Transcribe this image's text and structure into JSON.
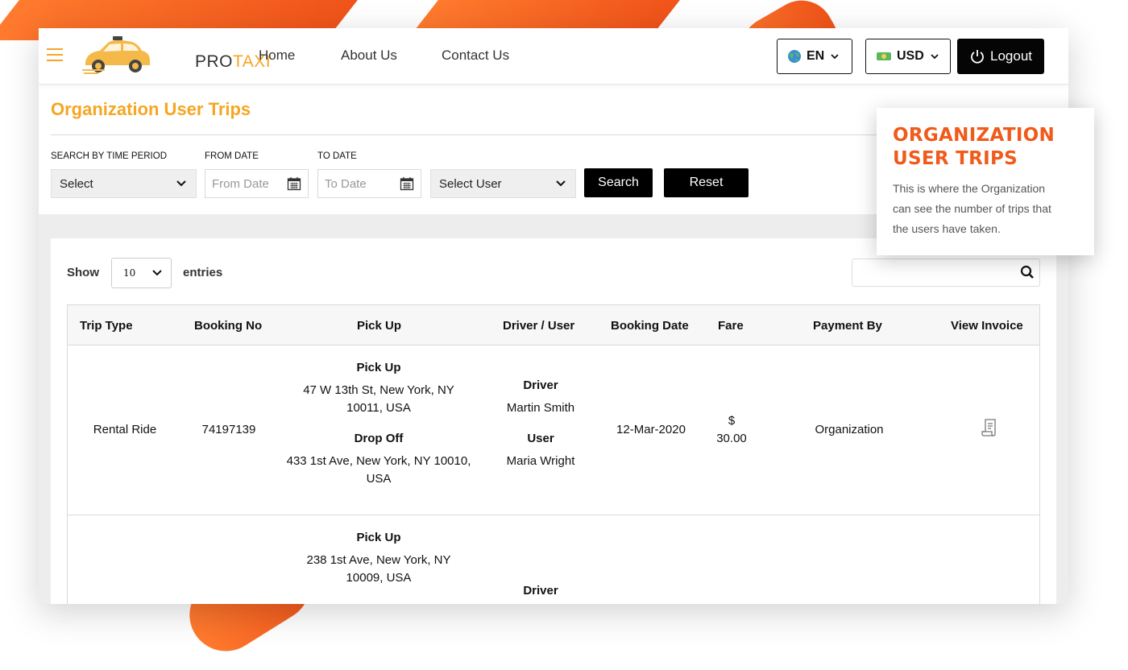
{
  "brand": {
    "pro": "PRO",
    "taxi": "TAXI",
    "accent": "#f5a623",
    "decor": "#f0541a"
  },
  "nav": {
    "home": "Home",
    "about": "About Us",
    "contact": "Contact Us"
  },
  "header": {
    "language": "EN",
    "currency": "USD",
    "logout": "Logout"
  },
  "page": {
    "title": "Organization User Trips"
  },
  "filters": {
    "time_label": "SEARCH BY TIME PERIOD",
    "time_value": "Select",
    "from_label": "FROM DATE",
    "from_placeholder": "From Date",
    "to_label": "TO DATE",
    "to_placeholder": "To Date",
    "user_value": "Select User",
    "search": "Search",
    "reset": "Reset"
  },
  "table_controls": {
    "show": "Show",
    "entries_value": "10",
    "entries": "entries"
  },
  "table": {
    "headers": [
      "Trip Type",
      "Booking No",
      "Pick Up",
      "Driver / User",
      "Booking Date",
      "Fare",
      "Payment By",
      "View Invoice"
    ],
    "rows": [
      {
        "trip_type": "Rental Ride",
        "booking_no": "74197139",
        "pickup_label": "Pick Up",
        "pickup_line1": "47 W 13th St, New York, NY",
        "pickup_line2": "10011, USA",
        "dropoff_label": "Drop Off",
        "dropoff_line1": "433 1st Ave, New York, NY 10010,",
        "dropoff_line2": "USA",
        "driver_label": "Driver",
        "driver": "Martin Smith",
        "user_label": "User",
        "user": "Maria Wright",
        "booking_date": "12-Mar-2020",
        "fare_symbol": "$",
        "fare_amount": "30.00",
        "payment_by": "Organization"
      },
      {
        "pickup_label": "Pick Up",
        "pickup_line1": "238 1st Ave, New York, NY",
        "pickup_line2": "10009, USA",
        "driver_label": "Driver"
      }
    ]
  },
  "tooltip": {
    "title_line1": "ORGANIZATION",
    "title_line2": "USER TRIPS",
    "text_line1": "This is where the Organization",
    "text_line2": "can see the number of trips that",
    "text_line3": "the users have taken."
  }
}
